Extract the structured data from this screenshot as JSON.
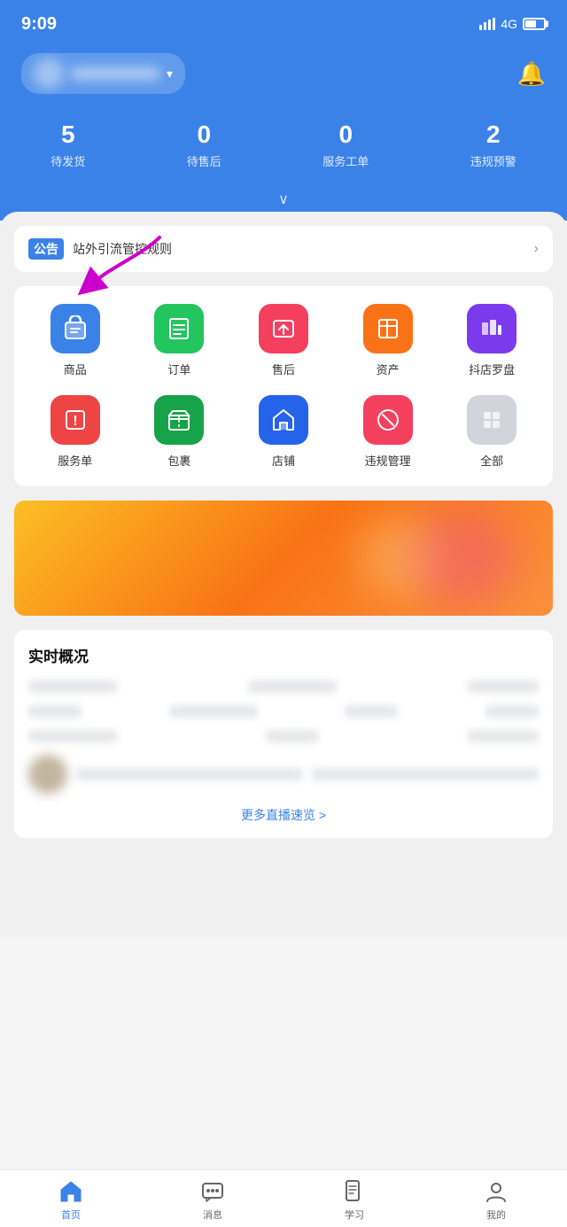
{
  "statusBar": {
    "time": "9:09",
    "signal": "4G"
  },
  "header": {
    "storeName": "店铺名称",
    "bellLabel": "通知"
  },
  "stats": [
    {
      "number": "5",
      "label": "待发货"
    },
    {
      "number": "0",
      "label": "待售后"
    },
    {
      "number": "0",
      "label": "服务工单"
    },
    {
      "number": "2",
      "label": "违规预警"
    }
  ],
  "announcement": {
    "tag": "公告",
    "text": "站外引流管控规则"
  },
  "menuRow1": [
    {
      "label": "商品",
      "icon": "🛍",
      "colorClass": "icon-blue"
    },
    {
      "label": "订单",
      "icon": "≡",
      "colorClass": "icon-green"
    },
    {
      "label": "售后",
      "icon": "↩",
      "colorClass": "icon-pink"
    },
    {
      "label": "资产",
      "icon": "📋",
      "colorClass": "icon-orange"
    },
    {
      "label": "抖店罗盘",
      "icon": "📊",
      "colorClass": "icon-purple"
    }
  ],
  "menuRow2": [
    {
      "label": "服务单",
      "icon": "!",
      "colorClass": "icon-red"
    },
    {
      "label": "包裹",
      "icon": "📦",
      "colorClass": "icon-green2"
    },
    {
      "label": "店铺",
      "icon": "🏠",
      "colorClass": "icon-blue2"
    },
    {
      "label": "违规管理",
      "icon": "🚫",
      "colorClass": "icon-pink"
    },
    {
      "label": "全部",
      "icon": "⋮⋮",
      "colorClass": "icon-gray"
    }
  ],
  "overview": {
    "title": "实时概况",
    "moreLive": "更多直播速览 >"
  },
  "bottomNav": [
    {
      "label": "首页",
      "icon": "⌂",
      "active": true
    },
    {
      "label": "消息",
      "icon": "💬",
      "active": false
    },
    {
      "label": "学习",
      "icon": "📖",
      "active": false
    },
    {
      "label": "我的",
      "icon": "👤",
      "active": false
    }
  ]
}
